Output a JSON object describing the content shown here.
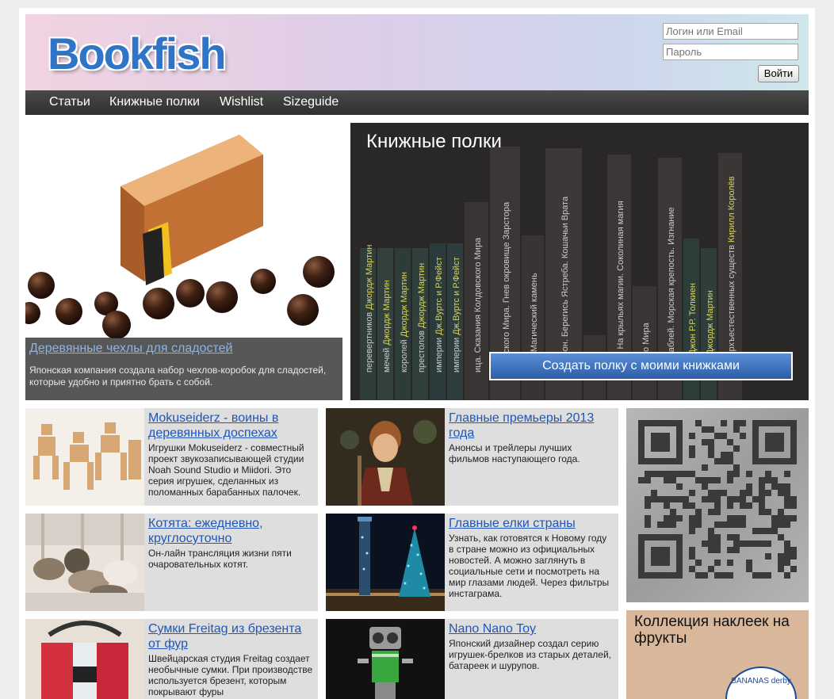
{
  "site": {
    "logo_text": "Bookfish"
  },
  "login": {
    "login_placeholder": "Логин или Email",
    "password_placeholder": "Пароль",
    "submit_label": "Войти"
  },
  "nav": {
    "items": [
      {
        "label": "Статьи"
      },
      {
        "label": "Книжные полки"
      },
      {
        "label": "Wishlist"
      },
      {
        "label": "Sizeguide"
      }
    ]
  },
  "featured": {
    "title": "Деревянные чехлы для сладостей",
    "description": "Японская компания создала набор чехлов-коробок для сладостей, которые удобно и приятно брать с собой."
  },
  "shelf": {
    "title": "Книжные полки",
    "button_label": "Создать полку с моими книжками",
    "spines": [
      {
        "title": "перевертников",
        "author": "Джордж Мартин"
      },
      {
        "title": "мечей",
        "author": "Джордж Мартин"
      },
      {
        "title": "королей",
        "author": "Джордж Мартин"
      },
      {
        "title": "престолов",
        "author": "Джордж Мартин"
      },
      {
        "title": "империи",
        "author": "Дж.Вуртс и Р.Фейст"
      },
      {
        "title": "империи",
        "author": "Дж.Вуртс и Р.Фейст"
      },
      {
        "title": "ица. Сказания Колдовского Мира",
        "author": ""
      },
      {
        "title": "лдовского Мира. Гнев окровище Зарстора",
        "author": ""
      },
      {
        "title": "ман. Магический камень",
        "author": ""
      },
      {
        "title": "Грифон. Берегись Ястреба. Кошачьи Врата",
        "author": ""
      },
      {
        "title": "ц",
        "author": ""
      },
      {
        "title": "тола. На крыльях магии. Соколиная магия",
        "author": ""
      },
      {
        "title": "вского Мира",
        "author": ""
      },
      {
        "title": "х кораблей. Морская крепость. Изгнание",
        "author": ""
      },
      {
        "title": "лец",
        "author": "Джон Р.Р. Толкиен"
      },
      {
        "title": "ала",
        "author": "Джордж Мартин"
      },
      {
        "title": "и сверхъестественных существ",
        "author": "Кирилл Королёв"
      }
    ]
  },
  "cards": [
    {
      "title": "Mokuseiderz - воины в деревянных доспехах",
      "description": "Игрушки Mokuseiderz - совместный проект звукозаписывающей студии Noah Sound Studio и Miidori. Это серия игрушек, сделанных из поломанных барабанных палочек."
    },
    {
      "title": "Главные премьеры 2013 года",
      "description": "Анонсы и трейлеры лучших фильмов наступающего года."
    },
    {
      "title": "Котята: ежедневно, круглосуточно",
      "description": "Он-лайн трансляция жизни пяти очаровательных котят."
    },
    {
      "title": "Главные елки страны",
      "description": "Узнать, как готовятся к Новому году в стране можно из официальных новостей. А можно заглянуть в социальные сети и посмотреть на мир глазами людей. Через фильтры инстаграма."
    },
    {
      "title": "Сумки Freitag из брезента от фур",
      "description": "Швейцарская студия Freitag создает необычные сумки. При производстве используется брезент, которым покрывают фуры"
    },
    {
      "title": "Nano Nano Toy",
      "description": "Японский дизайнер создал серию игрушек-брелков из старых деталей, батареек и шурупов."
    }
  ],
  "sidebar": {
    "stickers_title": "Коллекция наклеек на фрукты",
    "sticker_text": "BANANAS derby"
  }
}
